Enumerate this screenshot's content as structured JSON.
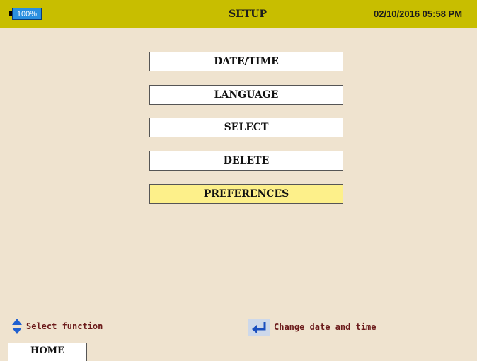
{
  "header": {
    "battery_label": "100%",
    "title": "SETUP",
    "datetime": "02/10/2016 05:58 PM"
  },
  "menu": {
    "items": [
      {
        "label": "DATE/TIME"
      },
      {
        "label": "LANGUAGE"
      },
      {
        "label": "SELECT"
      },
      {
        "label": "DELETE"
      },
      {
        "label": "PREFERENCES"
      }
    ],
    "selected_label": "PREFERENCES"
  },
  "hints": {
    "select_text": "Select function",
    "enter_text": "Change date and time"
  },
  "footer": {
    "home_tab": "HOME"
  },
  "colors": {
    "titlebar": "#c8be00",
    "background": "#efe3cf",
    "selected_item": "#fdf08a",
    "battery": "#2a8fe0",
    "hint_text": "#6b1a1a"
  },
  "icons": {
    "battery": "battery-icon",
    "select": "up-down-arrows-icon",
    "enter": "enter-arrow-icon"
  }
}
